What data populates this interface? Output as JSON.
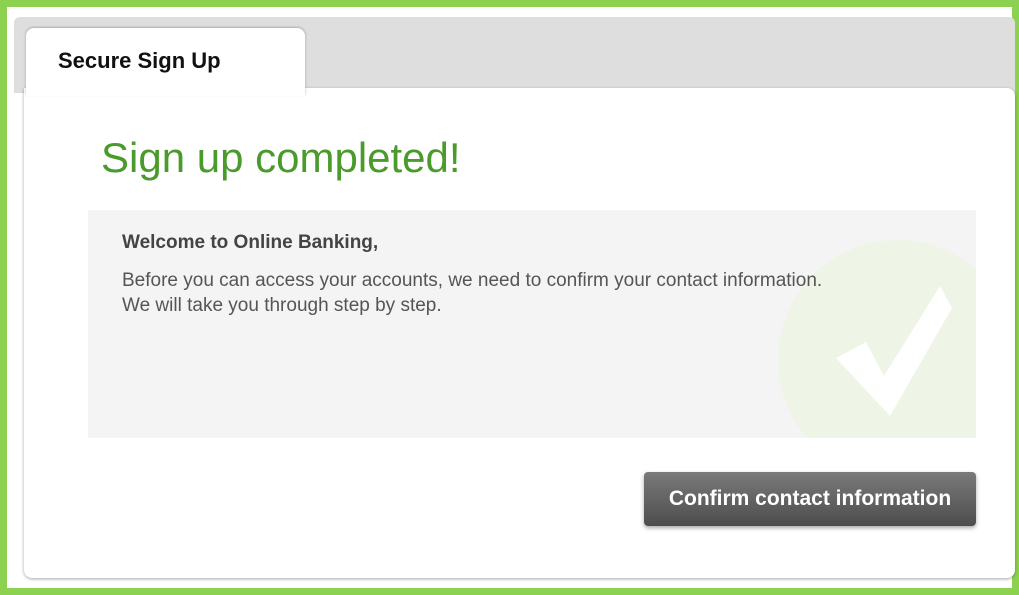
{
  "tab": {
    "label": "Secure Sign Up"
  },
  "main": {
    "title": "Sign up completed!",
    "message": {
      "heading": "Welcome to Online Banking,",
      "body": "Before you can access your accounts, we need to confirm your contact information. We will take you through step by step."
    },
    "confirm_button_label": "Confirm contact information"
  },
  "icons": {
    "success": "checkmark-icon"
  },
  "colors": {
    "frame_border": "#8cd14f",
    "title_green": "#4a9a2c",
    "button_dark": "#4d4d4d"
  }
}
